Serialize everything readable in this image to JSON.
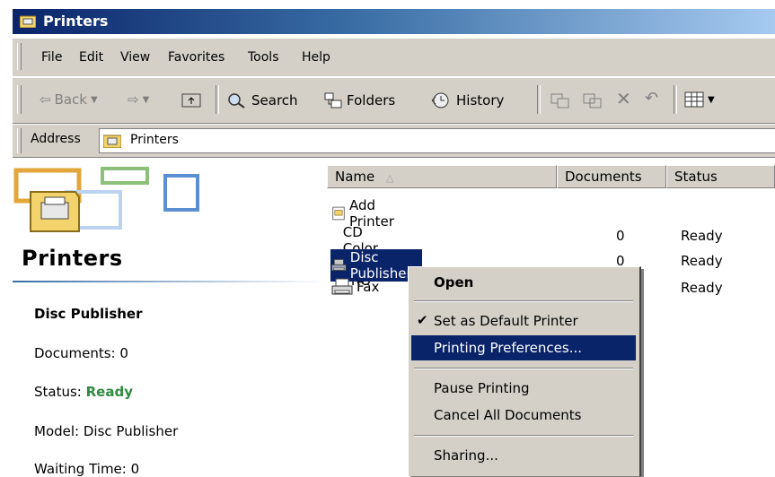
{
  "window": {
    "title": "Printers"
  },
  "menubar": {
    "items": [
      "File",
      "Edit",
      "View",
      "Favorites",
      "Tools",
      "Help"
    ]
  },
  "toolbar": {
    "back_label": "Back",
    "search_label": "Search",
    "folders_label": "Folders",
    "history_label": "History"
  },
  "address": {
    "label": "Address",
    "value": "Printers"
  },
  "info_pane": {
    "title": "Printers",
    "selected_name": "Disc Publisher",
    "documents": "Documents: 0",
    "status_label": "Status: ",
    "status_value": "Ready",
    "model": "Model: Disc Publisher",
    "waiting_time": "Waiting Time: 0"
  },
  "list": {
    "columns": [
      "Name",
      "Documents",
      "Status"
    ],
    "rows": [
      {
        "name": "Add Printer",
        "documents": "",
        "status": ""
      },
      {
        "name": "CD Color Printer PRO",
        "documents": "0",
        "status": "Ready"
      },
      {
        "name": "Disc Publisher",
        "documents": "0",
        "status": "Ready"
      },
      {
        "name": "Fax",
        "documents": "",
        "status": "Ready"
      }
    ]
  },
  "context_menu": {
    "open": "Open",
    "set_default": "Set as Default Printer",
    "printing_preferences": "Printing Preferences...",
    "pause_printing": "Pause Printing",
    "cancel_all": "Cancel All Documents",
    "sharing": "Sharing..."
  },
  "colors": {
    "selection": "#0a246a",
    "status_ready": "#2e8b3d",
    "chrome": "#d4d0c8"
  }
}
